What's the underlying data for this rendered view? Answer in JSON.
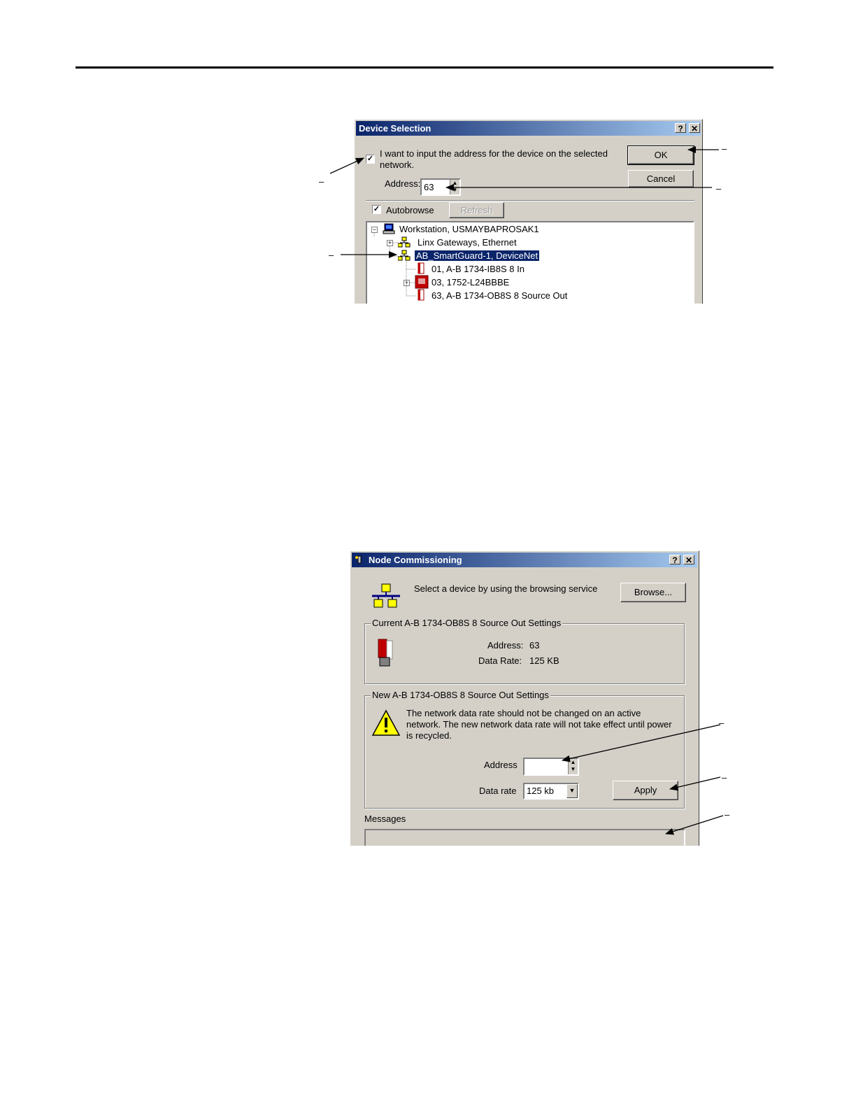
{
  "device_selection": {
    "title": "Device Selection",
    "help_btn": "?",
    "close_btn": "✕",
    "checkbox_label_line1": "I want to input the address for the device on the selected",
    "checkbox_label_line2": "network.",
    "checkbox_checked": true,
    "ok_label": "OK",
    "cancel_label": "Cancel",
    "address_label": "Address:",
    "address_value": "63",
    "autobrowse_label": "Autobrowse",
    "autobrowse_checked": true,
    "refresh_label": "Refresh",
    "tree": [
      {
        "label": "Workstation, USMAYBAPROSAK1",
        "icon": "computer-icon"
      },
      {
        "label": "Linx Gateways, Ethernet",
        "icon": "network-icon"
      },
      {
        "label": "AB_SmartGuard-1, DeviceNet",
        "icon": "network-icon",
        "selected": true
      },
      {
        "label": "01, A-B 1734-IB8S 8 In",
        "icon": "io-module-icon"
      },
      {
        "label": "03, 1752-L24BBBE",
        "icon": "controller-icon"
      },
      {
        "label": "63, A-B 1734-OB8S 8 Source Out",
        "icon": "io-module-icon"
      }
    ]
  },
  "node_commissioning": {
    "title": "Node Commissioning",
    "help_btn": "?",
    "close_btn": "✕",
    "browse_prompt": "Select a device by using the browsing service",
    "browse_label": "Browse...",
    "current_group": "Current A-B 1734-OB8S 8 Source Out Settings",
    "current_address_label": "Address:",
    "current_address_value": "63",
    "current_rate_label": "Data Rate:",
    "current_rate_value": "125 KB",
    "new_group": "New A-B 1734-OB8S 8 Source Out Settings",
    "warning_line1": "The network data rate should not be changed on an active",
    "warning_line2": "network. The new network data rate will not take effect until power",
    "warning_line3": "is recycled.",
    "address_label": "Address",
    "address_value": "",
    "data_rate_label": "Data rate",
    "data_rate_value": "125 kb",
    "apply_label": "Apply",
    "messages_label": "Messages"
  },
  "callouts": [
    "–",
    "–",
    "–",
    "–",
    "–",
    "–",
    "–"
  ],
  "colors": {
    "dialog_bg": "#d4d0c8",
    "title_start": "#0a246a",
    "title_end": "#a6caf0",
    "selection": "#0a246a"
  }
}
